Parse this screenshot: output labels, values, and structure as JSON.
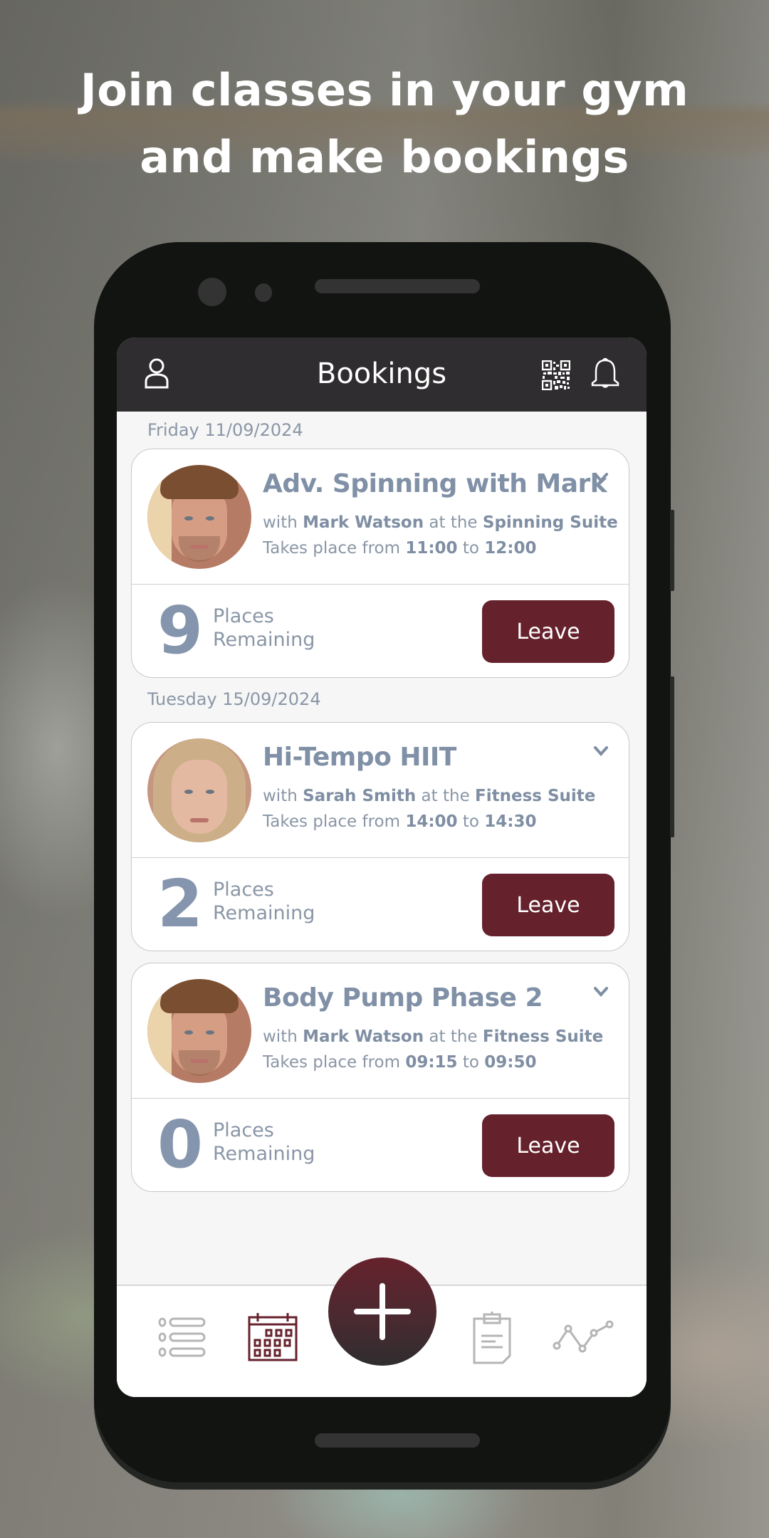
{
  "promo": {
    "headline_line1": "Join classes in your gym",
    "headline_line2": "and make bookings"
  },
  "app": {
    "title": "Bookings",
    "header_icons": [
      "user-icon",
      "qr-code-icon",
      "bell-icon"
    ],
    "accent_color": "#66222c",
    "header_bg": "#2f2d2f"
  },
  "bookings": [
    {
      "date": "Friday 11/09/2024",
      "class_name": "Adv. Spinning with Mark",
      "with_prefix": "with",
      "instructor": "Mark Watson",
      "at_prefix": "at the",
      "location": "Spinning Suite",
      "time_prefix": "Takes place from",
      "start": "11:00",
      "to": "to",
      "end": "12:00",
      "places_remaining": "9",
      "places_label_1": "Places",
      "places_label_2": "Remaining",
      "action": "Leave"
    },
    {
      "date": "Tuesday 15/09/2024",
      "class_name": "Hi-Tempo HIIT",
      "with_prefix": "with",
      "instructor": "Sarah Smith",
      "at_prefix": "at the",
      "location": "Fitness Suite",
      "time_prefix": "Takes place from",
      "start": "14:00",
      "to": "to",
      "end": "14:30",
      "places_remaining": "2",
      "places_label_1": "Places",
      "places_label_2": "Remaining",
      "action": "Leave"
    },
    {
      "date": "",
      "class_name": "Body Pump Phase 2",
      "with_prefix": "with",
      "instructor": "Mark Watson",
      "at_prefix": "at the",
      "location": "Fitness Suite",
      "time_prefix": "Takes place from",
      "start": "09:15",
      "to": "to",
      "end": "09:50",
      "places_remaining": "0",
      "places_label_1": "Places",
      "places_label_2": "Remaining",
      "action": "Leave"
    }
  ],
  "tabbar": {
    "items": [
      "list-icon",
      "calendar-icon",
      "add-icon",
      "clipboard-icon",
      "progress-chart-icon"
    ],
    "active": "calendar-icon"
  }
}
